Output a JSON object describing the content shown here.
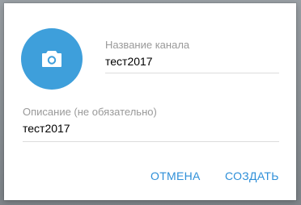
{
  "dialog": {
    "avatar": {
      "icon": "camera-icon",
      "color": "#3e9fdb"
    },
    "channel_name": {
      "label": "Название канала",
      "value": "тест2017"
    },
    "description": {
      "label": "Описание (не обязательно)",
      "value": "тест2017"
    },
    "buttons": {
      "cancel": "ОТМЕНА",
      "create": "СОЗДАТЬ"
    },
    "accent_color": "#2e8fd8"
  }
}
